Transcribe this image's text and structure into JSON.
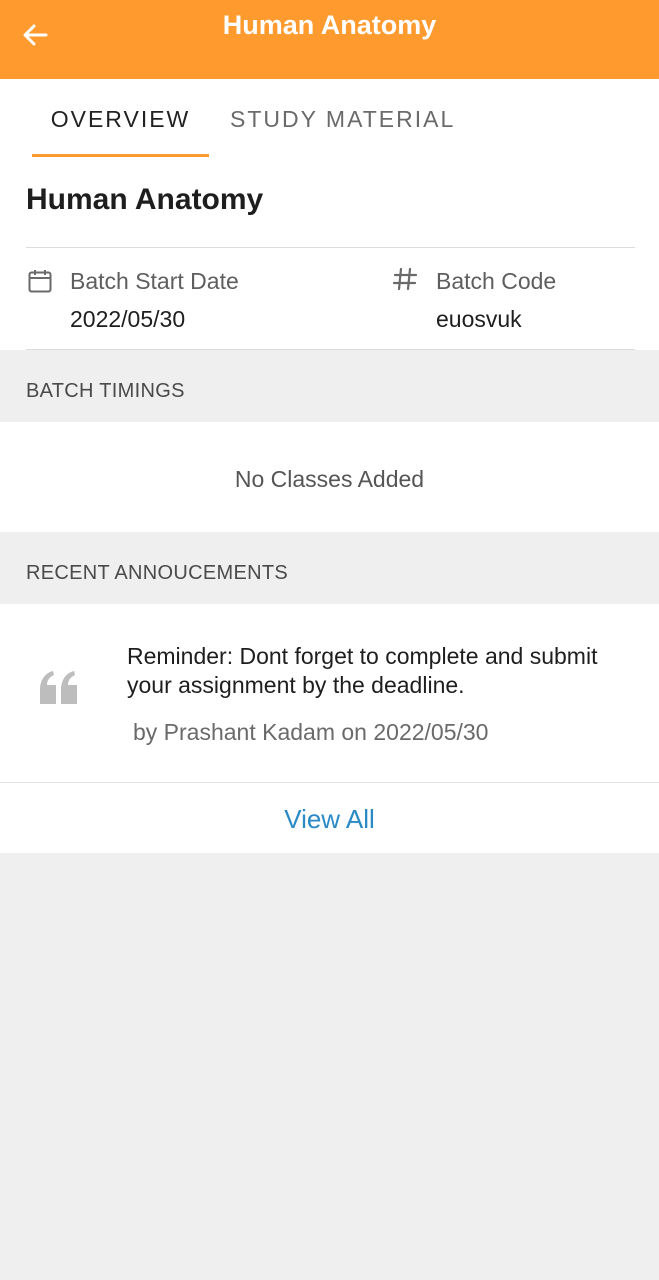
{
  "appbar": {
    "title": "Human Anatomy",
    "back_icon": "arrow-left-icon",
    "color": "#ff9a2e"
  },
  "tabs": [
    {
      "label": "OVERVIEW",
      "active": true
    },
    {
      "label": "STUDY MATERIAL",
      "active": false
    }
  ],
  "course": {
    "title": "Human Anatomy",
    "start_date_label": "Batch Start Date",
    "start_date_value": "2022/05/30",
    "start_date_icon": "calendar-icon",
    "code_label": "Batch Code",
    "code_value": "euosvuk",
    "code_icon": "hash-icon"
  },
  "batch_timings": {
    "header": "BATCH TIMINGS",
    "empty_text": "No Classes Added"
  },
  "announcements": {
    "header": "RECENT ANNOUCEMENTS",
    "items": [
      {
        "text": "Reminder: Dont forget to complete and submit your assignment by the deadline.",
        "byline": "by Prashant Kadam on 2022/05/30",
        "icon": "quote-icon"
      }
    ],
    "view_all_label": "View All",
    "link_color": "#2a8ac6"
  }
}
